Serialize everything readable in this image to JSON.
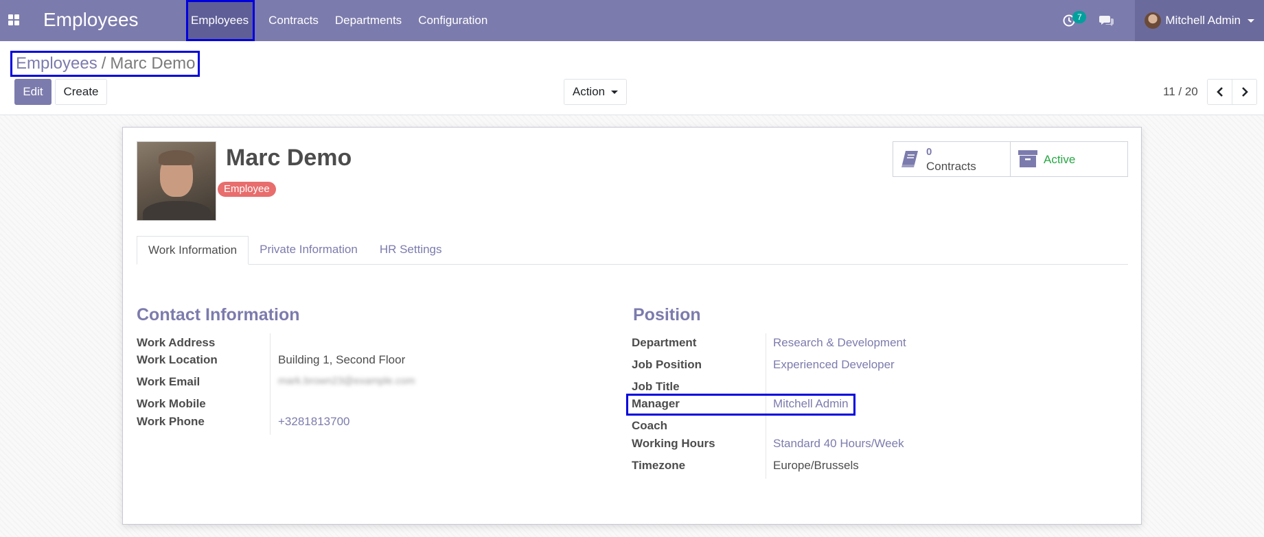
{
  "navbar": {
    "app_title": "Employees",
    "menu": [
      "Employees",
      "Contracts",
      "Departments",
      "Configuration"
    ],
    "activity_count": "7",
    "user_name": "Mitchell Admin"
  },
  "control_panel": {
    "breadcrumb_parent": "Employees",
    "breadcrumb_separator": "/",
    "breadcrumb_current": "Marc Demo",
    "edit_label": "Edit",
    "create_label": "Create",
    "action_label": "Action",
    "pager_value": "11 / 20"
  },
  "employee": {
    "name": "Marc Demo",
    "tag": "Employee",
    "contracts_count": "0",
    "contracts_label": "Contracts",
    "status_label": "Active"
  },
  "tabs": [
    "Work Information",
    "Private Information",
    "HR Settings"
  ],
  "contact": {
    "title": "Contact Information",
    "work_address_label": "Work Address",
    "work_address": "",
    "work_location_label": "Work Location",
    "work_location": "Building 1, Second Floor",
    "work_email_label": "Work Email",
    "work_email": "mark.brown23@example.com",
    "work_mobile_label": "Work Mobile",
    "work_mobile": "",
    "work_phone_label": "Work Phone",
    "work_phone": "+3281813700"
  },
  "position": {
    "title": "Position",
    "department_label": "Department",
    "department": "Research & Development",
    "job_position_label": "Job Position",
    "job_position": "Experienced Developer",
    "job_title_label": "Job Title",
    "job_title": "",
    "manager_label": "Manager",
    "manager": "Mitchell Admin",
    "coach_label": "Coach",
    "coach": "",
    "working_hours_label": "Working Hours",
    "working_hours": "Standard 40 Hours/Week",
    "timezone_label": "Timezone",
    "timezone": "Europe/Brussels"
  },
  "colors": {
    "brand": "#7c7bad",
    "tag": "#e86d6d",
    "active": "#28a745",
    "activity_badge": "#00a09d",
    "annotation": "#0000dd"
  },
  "icons": [
    "apps-icon",
    "activity-clock-icon",
    "chat-icon",
    "user-avatar",
    "chevron-left-icon",
    "chevron-right-icon",
    "book-icon",
    "archive-icon"
  ]
}
